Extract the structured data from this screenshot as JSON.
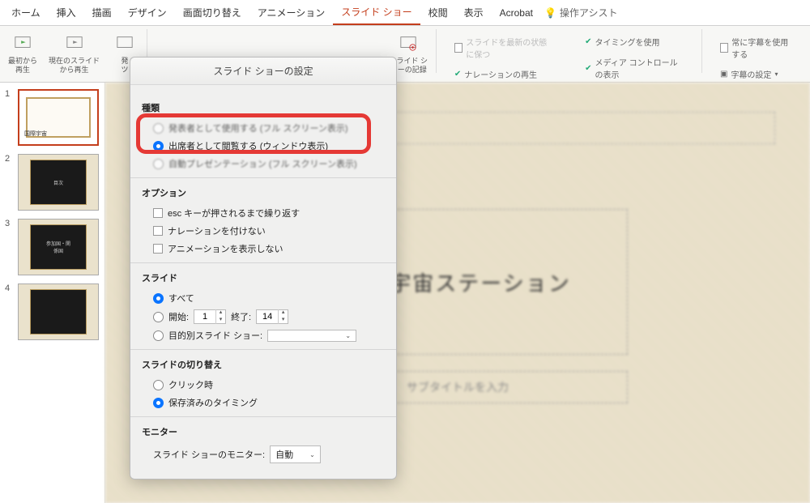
{
  "tabs": {
    "home": "ホーム",
    "insert": "挿入",
    "draw": "描画",
    "design": "デザイン",
    "transition": "画面切り替え",
    "animation": "アニメーション",
    "slideshow": "スライド ショー",
    "review": "校閲",
    "view": "表示",
    "acrobat": "Acrobat",
    "assist": "操作アシスト"
  },
  "ribbon": {
    "from_start1": "最初から",
    "from_start2": "再生",
    "from_current1": "現在のスライド",
    "from_current2": "から再生",
    "presenter1": "発",
    "presenter2": "ツ",
    "rec_label1": "スライド シ",
    "rec_label2": "ョーの記録",
    "keep_latest": "スライドを最新の状態に保つ",
    "use_timing": "タイミングを使用",
    "play_narr": "ナレーションの再生",
    "media_ctrl": "メディア コントロールの表示",
    "subtitles_always": "常に字幕を使用する",
    "subtitle_settings": "字幕の設定"
  },
  "thumbs": {
    "t1": "国際宇宙",
    "t2": "目次",
    "t3": "参加国・関\n係国"
  },
  "canvas": {
    "title": "国際宇宙ステーション",
    "subtitle": "サブタイトルを入力"
  },
  "dialog": {
    "title": "スライド ショーの設定",
    "sect_type": "種類",
    "type_opt1": "発表者として使用する (フル スクリーン表示)",
    "type_opt2": "出席者として閲覧する (ウィンドウ表示)",
    "type_opt3": "自動プレゼンテーション (フル スクリーン表示)",
    "sect_options": "オプション",
    "opt_esc": "esc キーが押されるまで繰り返す",
    "opt_nonarr": "ナレーションを付けない",
    "opt_noanim": "アニメーションを表示しない",
    "sect_slides": "スライド",
    "slides_all": "すべて",
    "slides_from": "開始:",
    "slides_to": "終了:",
    "from_val": "1",
    "to_val": "14",
    "custom_show": "目的別スライド ショー:",
    "sect_advance": "スライドの切り替え",
    "adv_click": "クリック時",
    "adv_timing": "保存済みのタイミング",
    "sect_monitor": "モニター",
    "monitor_label": "スライド ショーのモニター:",
    "monitor_val": "自動"
  }
}
